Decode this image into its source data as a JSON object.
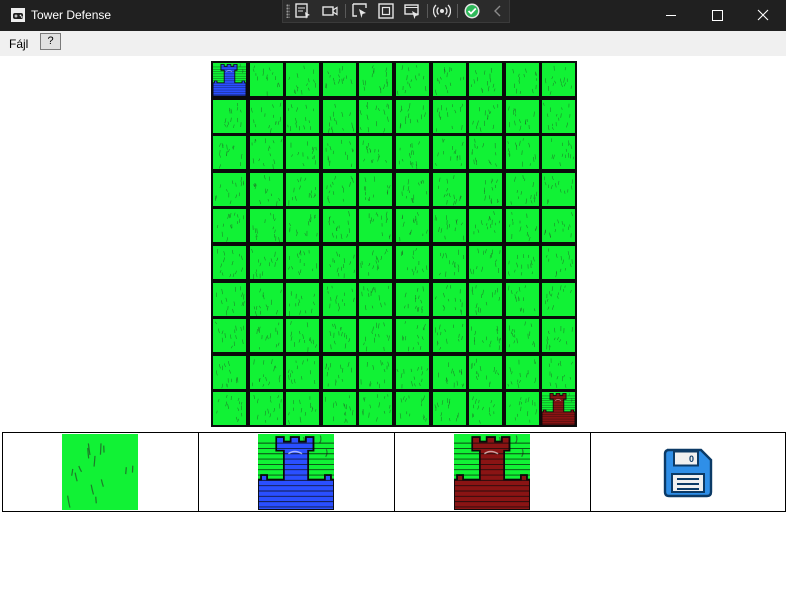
{
  "window": {
    "title": "Tower Defense",
    "icon": "controller-icon"
  },
  "toolbar": {
    "icons": [
      "select-window-icon",
      "video-camera-icon",
      "pointer-region-icon",
      "fullscreen-frame-icon",
      "window-capture-icon",
      "live-signal-icon",
      "checkmark-icon",
      "collapse-chevron-icon"
    ]
  },
  "menu": {
    "file_label": "Fájl",
    "help_label": "?"
  },
  "board": {
    "rows": 10,
    "cols": 10,
    "default_tile": "grass",
    "special_tiles": [
      {
        "row": 0,
        "col": 0,
        "type": "blue-tower"
      },
      {
        "row": 9,
        "col": 9,
        "type": "red-tower"
      }
    ]
  },
  "palette": {
    "items": [
      "grass",
      "blue-tower",
      "red-tower",
      "save"
    ],
    "save_icon_label": "0"
  },
  "colors": {
    "grass": "#11f235",
    "grass_blade": "#1f7a2a",
    "blue_tower": "#2a4fff",
    "red_tower": "#8a1414",
    "grid_line": "#0b0b0b",
    "save_icon": "#2f8fe8"
  }
}
